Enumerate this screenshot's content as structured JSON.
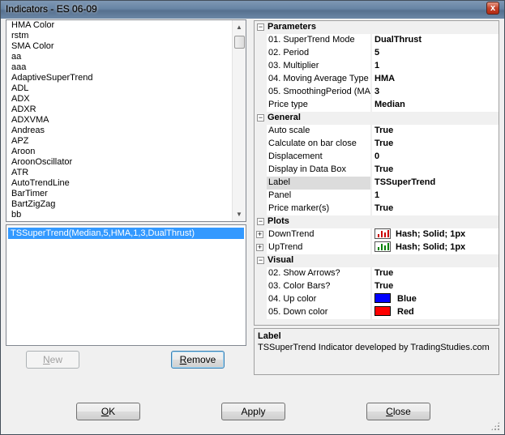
{
  "window": {
    "title": "Indicators - ES 06-09",
    "close_glyph": "x"
  },
  "indicator_list": {
    "items": [
      " HMA Color",
      " rstm",
      " SMA Color",
      "aa",
      "aaa",
      "AdaptiveSuperTrend",
      "ADL",
      "ADX",
      "ADXR",
      "ADXVMA",
      "Andreas",
      "APZ",
      "Aroon",
      "AroonOscillator",
      "ATR",
      "AutoTrendLine",
      "BarTimer",
      "BartZigZag",
      "bb"
    ]
  },
  "configured_list": {
    "items": [
      "TSSuperTrend(Median,5,HMA,1,3,DualThrust)"
    ]
  },
  "buttons": {
    "new": {
      "pre": "",
      "accel": "N",
      "post": "ew"
    },
    "remove": {
      "pre": "",
      "accel": "R",
      "post": "emove"
    },
    "ok": {
      "pre": "",
      "accel": "O",
      "post": "K"
    },
    "apply": {
      "pre": "Apply",
      "accel": "",
      "post": ""
    },
    "close": {
      "pre": "",
      "accel": "C",
      "post": "lose"
    }
  },
  "property_grid": {
    "categories": [
      {
        "name": "Parameters",
        "rows": [
          {
            "name": "01. SuperTrend Mode",
            "value": "DualThrust"
          },
          {
            "name": "02. Period",
            "value": "5"
          },
          {
            "name": "03. Multiplier",
            "value": "1"
          },
          {
            "name": "04. Moving Average Type",
            "value": "HMA"
          },
          {
            "name": "05. SmoothingPeriod (MA",
            "value": "3"
          },
          {
            "name": "Price type",
            "value": "Median"
          }
        ]
      },
      {
        "name": "General",
        "rows": [
          {
            "name": "Auto scale",
            "value": "True"
          },
          {
            "name": "Calculate on bar close",
            "value": "True"
          },
          {
            "name": "Displacement",
            "value": "0"
          },
          {
            "name": "Display in Data Box",
            "value": "True"
          },
          {
            "name": "Label",
            "value": "TSSuperTrend",
            "selected": true
          },
          {
            "name": "Panel",
            "value": "1"
          },
          {
            "name": "Price marker(s)",
            "value": "True"
          }
        ]
      },
      {
        "name": "Plots",
        "rows": [
          {
            "name": "DownTrend",
            "value": "Hash; Solid; 1px",
            "icon_color": "#cc0000",
            "expandable": true
          },
          {
            "name": "UpTrend",
            "value": "Hash; Solid; 1px",
            "icon_color": "#008000",
            "expandable": true
          }
        ]
      },
      {
        "name": "Visual",
        "rows": [
          {
            "name": "02. Show Arrows?",
            "value": "True"
          },
          {
            "name": "03. Color Bars?",
            "value": "True"
          },
          {
            "name": "04. Up color",
            "value": "Blue",
            "swatch": "#0000ff"
          },
          {
            "name": "05. Down color",
            "value": "Red",
            "swatch": "#ff0000"
          }
        ]
      }
    ],
    "toggle_collapse": "−",
    "toggle_expand": "+"
  },
  "description": {
    "title": "Label",
    "text": "TSSuperTrend Indicator developed by TradingStudies.com"
  }
}
